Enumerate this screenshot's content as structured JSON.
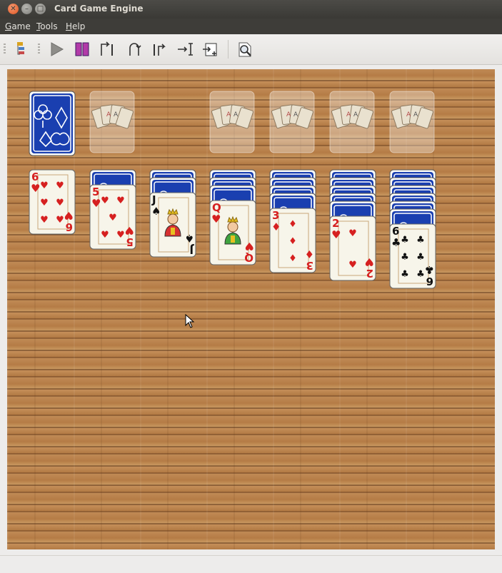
{
  "window": {
    "title": "Card Game Engine"
  },
  "menu": [
    {
      "label": "Game",
      "mnemonic": "G",
      "rest": "ame"
    },
    {
      "label": "Tools",
      "mnemonic": "T",
      "rest": "ools"
    },
    {
      "label": "Help",
      "mnemonic": "H",
      "rest": "elp"
    }
  ],
  "toolbar": {
    "icons": [
      "game-rules-icon",
      "play-icon",
      "pause-icon",
      "step-forward-icon",
      "undo-icon",
      "redo-icon",
      "jump-to-end-icon",
      "add-move-icon",
      "zoom-icon"
    ]
  },
  "colors": {
    "red_suit": "#d62020",
    "black_suit": "#111111",
    "card_back": "#1a3fb0",
    "wood": "#b9814a"
  },
  "foundations": [
    {
      "state": "empty",
      "icon": "foundation-placeholder-icon"
    },
    {
      "state": "empty",
      "icon": "foundation-placeholder-icon"
    },
    {
      "state": "empty",
      "icon": "foundation-placeholder-icon"
    },
    {
      "state": "empty",
      "icon": "foundation-placeholder-icon"
    },
    {
      "state": "empty",
      "icon": "foundation-placeholder-icon"
    }
  ],
  "stock": {
    "state": "face-down"
  },
  "tableau": [
    {
      "face_down": 0,
      "face_up": [
        {
          "rank": "6",
          "suit": "♥",
          "color": "red"
        }
      ]
    },
    {
      "face_down": 1,
      "face_up": [
        {
          "rank": "5",
          "suit": "♥",
          "color": "red"
        }
      ]
    },
    {
      "face_down": 2,
      "face_up": [
        {
          "rank": "J",
          "suit": "♠",
          "color": "black"
        }
      ]
    },
    {
      "face_down": 3,
      "face_up": [
        {
          "rank": "Q",
          "suit": "♥",
          "color": "red"
        }
      ]
    },
    {
      "face_down": 4,
      "face_up": [
        {
          "rank": "3",
          "suit": "♦",
          "color": "red"
        }
      ]
    },
    {
      "face_down": 5,
      "face_up": [
        {
          "rank": "2",
          "suit": "♥",
          "color": "red"
        }
      ]
    },
    {
      "face_down": 6,
      "face_up": [
        {
          "rank": "6",
          "suit": "♣",
          "color": "black"
        }
      ]
    }
  ],
  "status": ""
}
